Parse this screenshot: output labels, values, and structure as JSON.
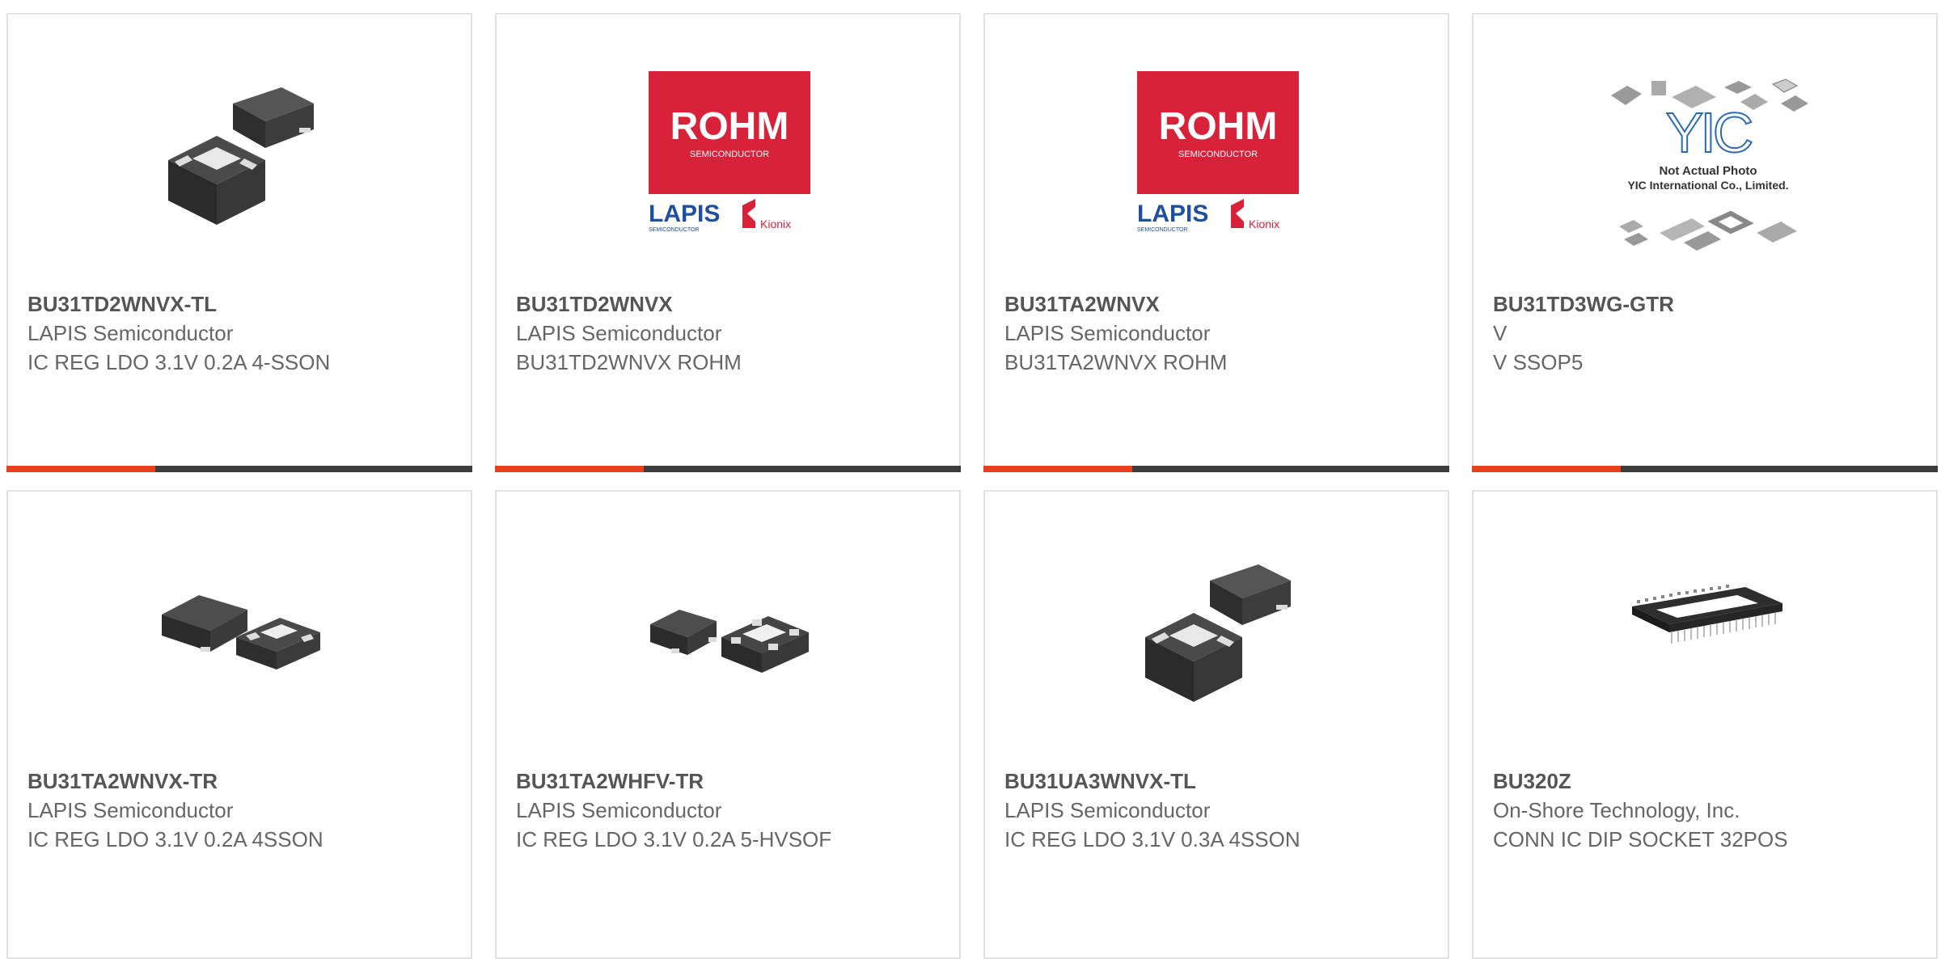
{
  "cards": [
    {
      "part_number": "BU31TD2WNVX-TL",
      "manufacturer": "LAPIS Semiconductor",
      "description": "IC REG LDO 3.1V 0.2A 4-SSON",
      "image": "chip-package-3d-icon"
    },
    {
      "part_number": "BU31TD2WNVX",
      "manufacturer": "LAPIS Semiconductor",
      "description": "BU31TD2WNVX ROHM",
      "image": "rohm-lapis-logo",
      "logo": {
        "brand": "ROHM",
        "brand_sub": "SEMICONDUCTOR",
        "lapis": "LAPIS",
        "lapis_sub": "SEMICONDUCTOR",
        "kionix": "Kionix"
      }
    },
    {
      "part_number": "BU31TA2WNVX",
      "manufacturer": "LAPIS Semiconductor",
      "description": "BU31TA2WNVX ROHM",
      "image": "rohm-lapis-logo",
      "logo": {
        "brand": "ROHM",
        "brand_sub": "SEMICONDUCTOR",
        "lapis": "LAPIS",
        "lapis_sub": "SEMICONDUCTOR",
        "kionix": "Kionix"
      }
    },
    {
      "part_number": "BU31TD3WG-GTR",
      "manufacturer": "V",
      "description": "V SSOP5",
      "image": "yic-placeholder-image",
      "placeholder": {
        "line1": "Not Actual Photo",
        "line2": "YIC International Co., Limited."
      }
    },
    {
      "part_number": "BU31TA2WNVX-TR",
      "manufacturer": "LAPIS Semiconductor",
      "description": "IC REG LDO 3.1V 0.2A 4SSON",
      "image": "chip-package-flat-icon"
    },
    {
      "part_number": "BU31TA2WHFV-TR",
      "manufacturer": "LAPIS Semiconductor",
      "description": "IC REG LDO 3.1V 0.2A 5-HVSOF",
      "image": "chip-package-hvsof-icon"
    },
    {
      "part_number": "BU31UA3WNVX-TL",
      "manufacturer": "LAPIS Semiconductor",
      "description": "IC REG LDO 3.1V 0.3A 4SSON",
      "image": "chip-package-3d-icon"
    },
    {
      "part_number": "BU320Z",
      "manufacturer": "On-Shore Technology, Inc.",
      "description": "CONN IC DIP SOCKET 32POS",
      "image": "dip-socket-icon"
    }
  ],
  "colors": {
    "accent": "#e8401c",
    "bar": "#3c3c3c",
    "rohm_red": "#d7223a",
    "lapis_blue": "#1f4fa0",
    "yic_blue": "#2a6bb3"
  }
}
